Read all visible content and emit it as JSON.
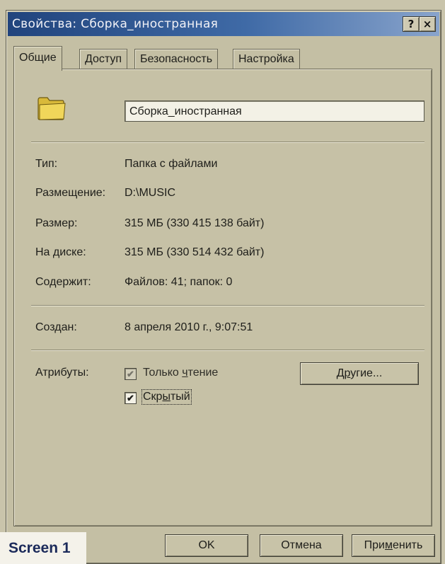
{
  "window": {
    "title": "Свойства: Сборка_иностранная",
    "help_label": "?",
    "close_label": "×"
  },
  "tabs": [
    {
      "label": "Общие",
      "active": true
    },
    {
      "label": "Доступ",
      "active": false
    },
    {
      "label": "Безопасность",
      "active": false
    },
    {
      "label": "Настройка",
      "active": false
    }
  ],
  "general": {
    "folder_icon": "folder-icon",
    "name_value": "Сборка_иностранная",
    "type_label": "Тип:",
    "type_value": "Папка с файлами",
    "location_label": "Размещение:",
    "location_value": "D:\\MUSIC",
    "size_label": "Размер:",
    "size_value": "315 МБ (330 415 138 байт)",
    "ondisk_label": "На диске:",
    "ondisk_value": "315 МБ (330 514 432 байт)",
    "contains_label": "Содержит:",
    "contains_value": "Файлов: 41; папок: 0",
    "created_label": "Создан:",
    "created_value": "8 апреля 2010 г., 9:07:51",
    "attributes_label": "Атрибуты:",
    "readonly": {
      "pre": "Только ",
      "u": "ч",
      "post": "тение",
      "checked": true,
      "enabled": false
    },
    "hidden": {
      "pre": "Скр",
      "u": "ы",
      "post": "тый",
      "checked": true,
      "enabled": true
    },
    "other_button": {
      "pre": "Д",
      "u": "р",
      "post": "угие..."
    }
  },
  "footer": {
    "ok": "OK",
    "cancel": "Отмена",
    "apply": {
      "pre": "При",
      "u": "м",
      "post": "енить"
    }
  },
  "caption": "Screen 1",
  "colors": {
    "titlebar_start": "#21447d",
    "titlebar_end": "#89a4cc",
    "face": "#c4bfa4",
    "caption_text": "#1b2a5a"
  }
}
